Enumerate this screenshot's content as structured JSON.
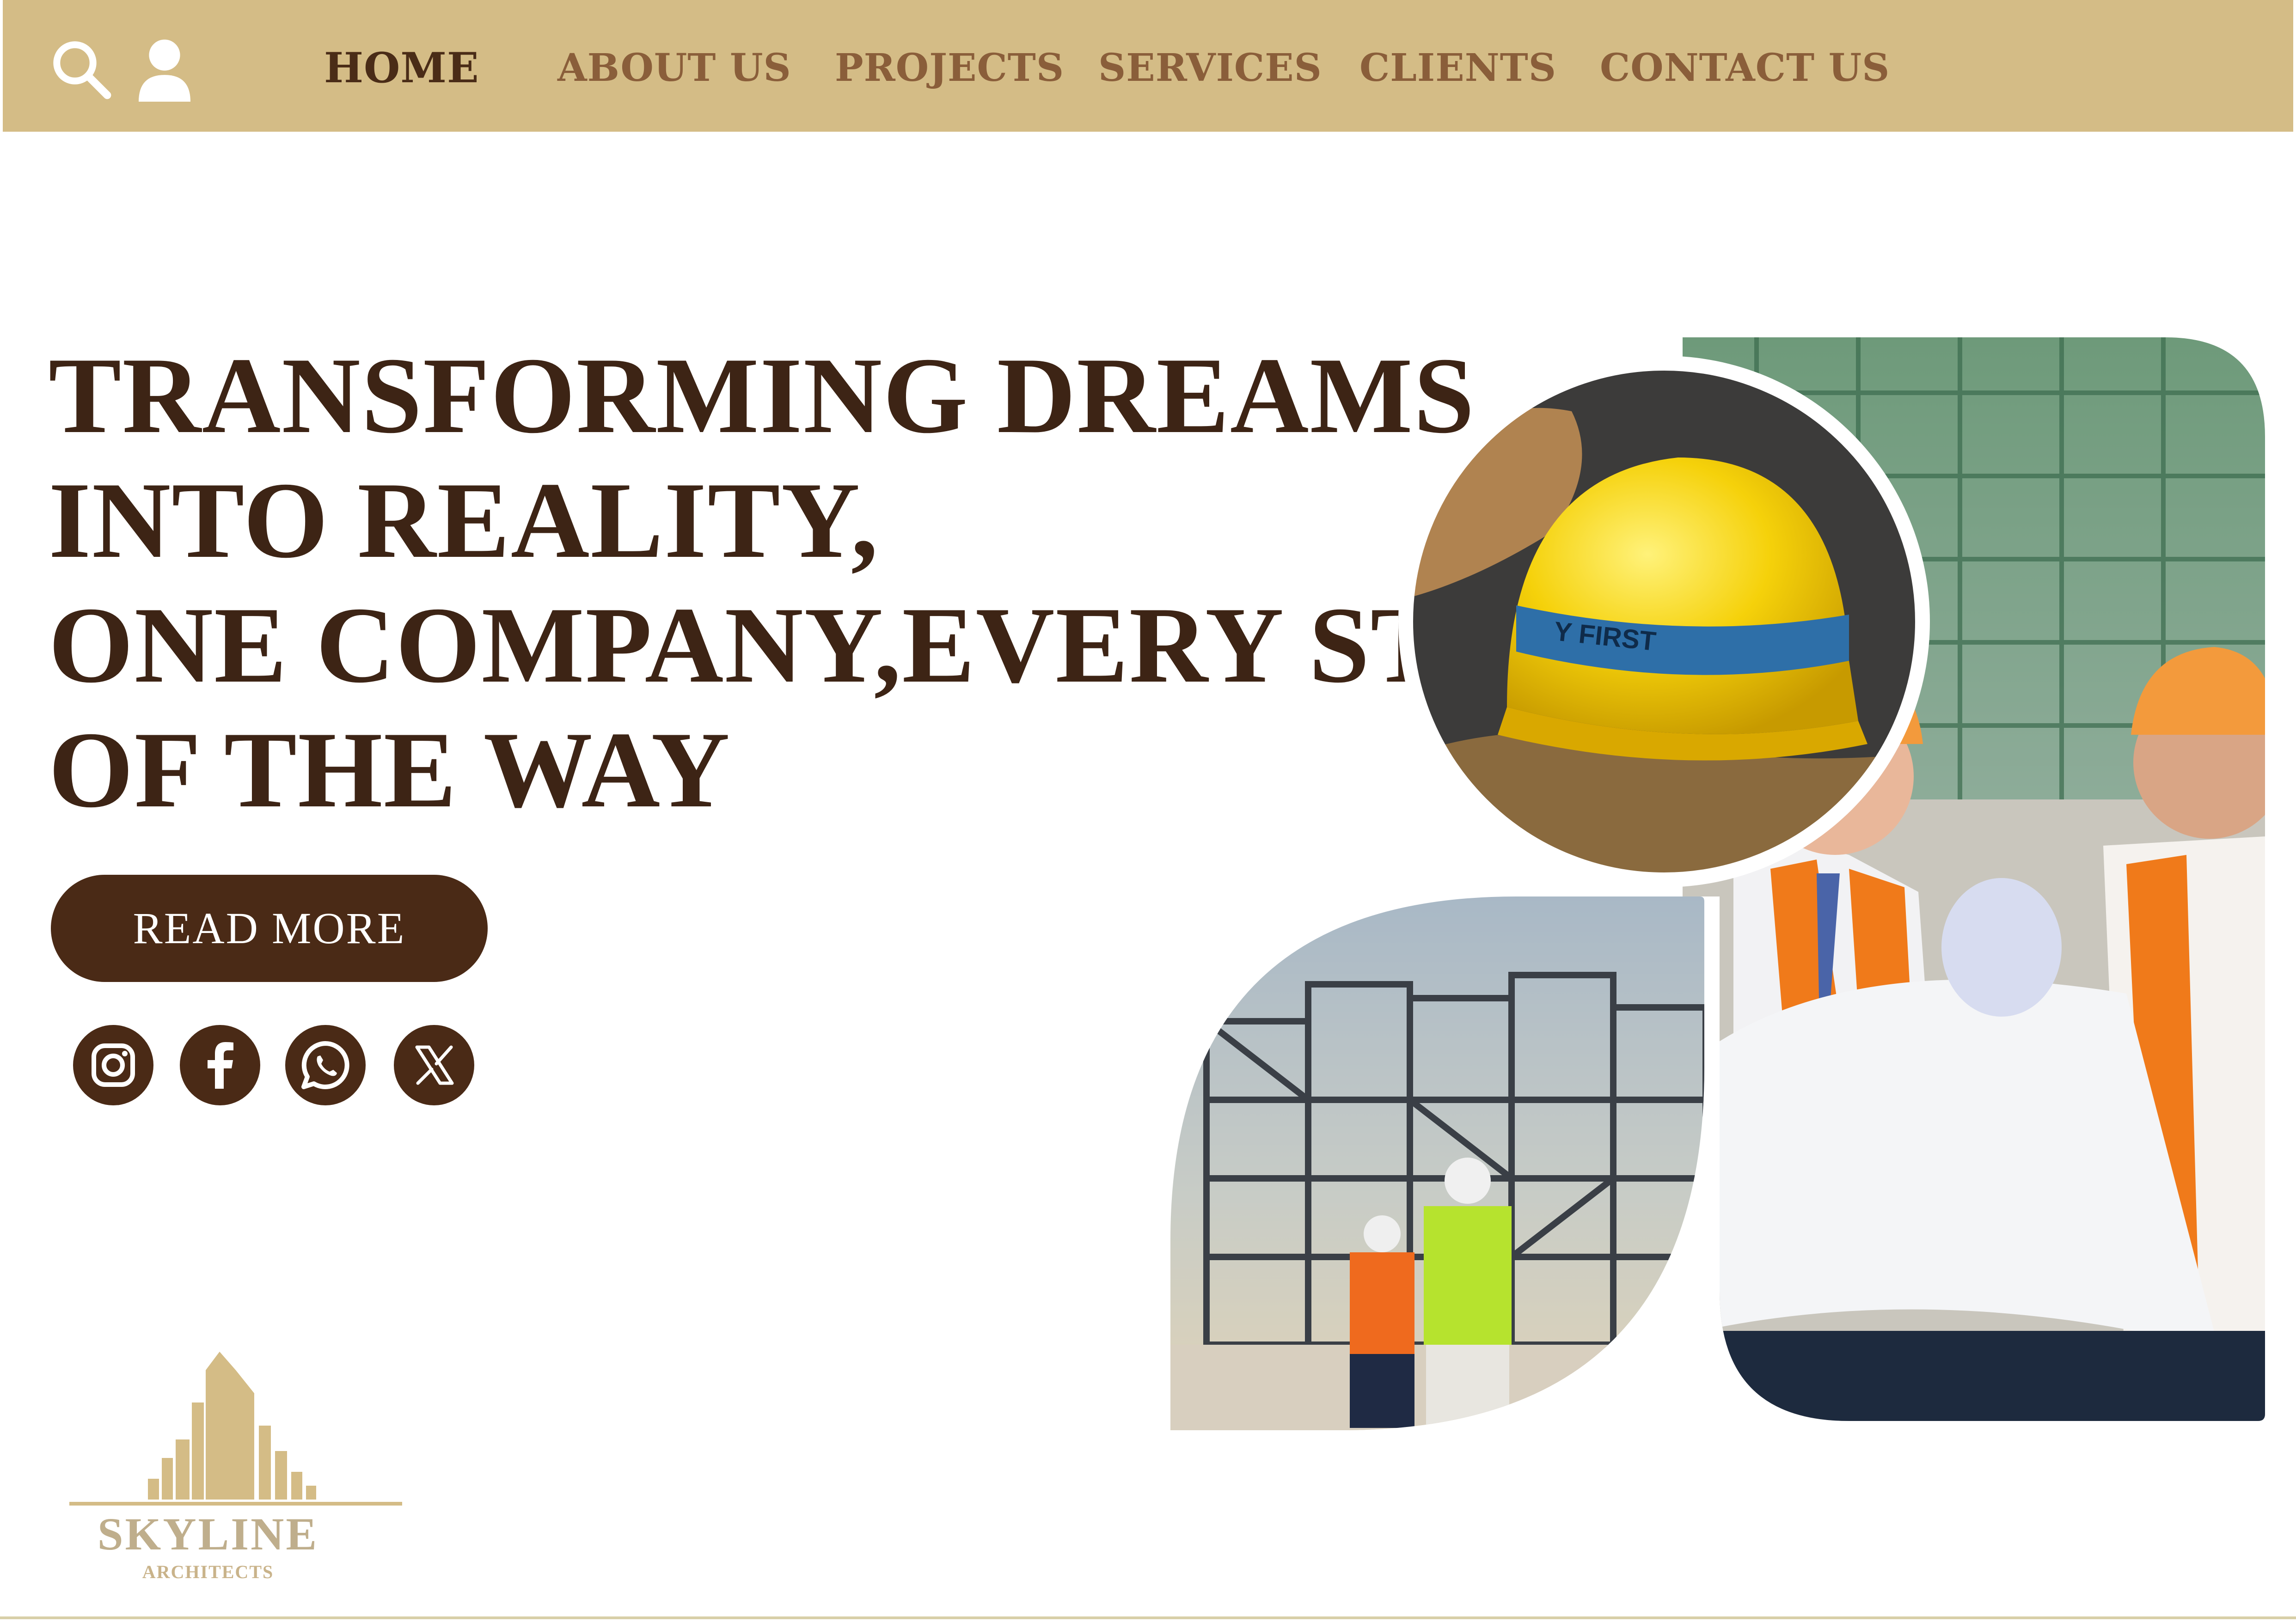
{
  "nav": {
    "links": [
      {
        "label": "HOME",
        "active": true
      },
      {
        "label": "ABOUT US",
        "active": false
      },
      {
        "label": "PROJECTS",
        "active": false
      },
      {
        "label": "SERVICES",
        "active": false
      },
      {
        "label": "CLIENTS",
        "active": false
      },
      {
        "label": "CONTACT US",
        "active": false
      }
    ],
    "icons": [
      "search-icon",
      "user-icon"
    ]
  },
  "hero": {
    "headline_lines": [
      "TRANSFORMING DREAMS",
      "INTO REALITY,",
      "ONE COMPANY,EVERY STEP",
      "OF THE WAY"
    ],
    "cta_label": "READ MORE"
  },
  "social": [
    "instagram-icon",
    "facebook-icon",
    "whatsapp-icon",
    "x-icon"
  ],
  "photos": {
    "helmet_strap_text": "Y FIRST"
  },
  "logo": {
    "wordmark": "SKYLINE",
    "tagline": "ARCHITECTS"
  },
  "colors": {
    "nav_bg": "#d4bc86",
    "brand_dark": "#4a2a16",
    "headline": "#3d2415",
    "nav_text": "#8a5e3a",
    "logo_gold": "#d4bc86"
  }
}
